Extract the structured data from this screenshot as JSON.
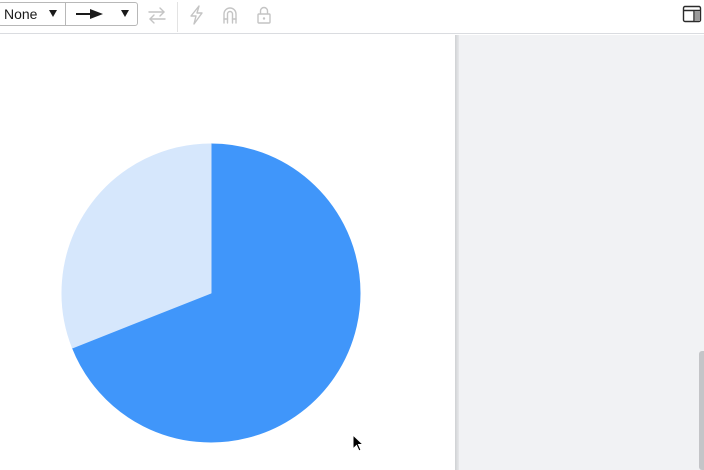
{
  "toolbar": {
    "line_start_value": "None",
    "line_end_value": "arrow",
    "icons": [
      "swap-arrows-icon",
      "lightning-icon",
      "magnet-icon",
      "lock-icon",
      "format-panel-icon"
    ]
  },
  "chart_data": {
    "type": "pie",
    "title": "",
    "slices": [
      {
        "value": 69,
        "color": "#4096fa"
      },
      {
        "value": 31,
        "color": "#d6e7fc"
      }
    ],
    "start_angle_deg": 0,
    "direction": "clockwise",
    "labels_shown": false,
    "legend": "none"
  },
  "colors": {
    "panel_bg": "#f1f2f4",
    "primary_slice": "#4096fa",
    "secondary_slice": "#d6e7fc"
  }
}
